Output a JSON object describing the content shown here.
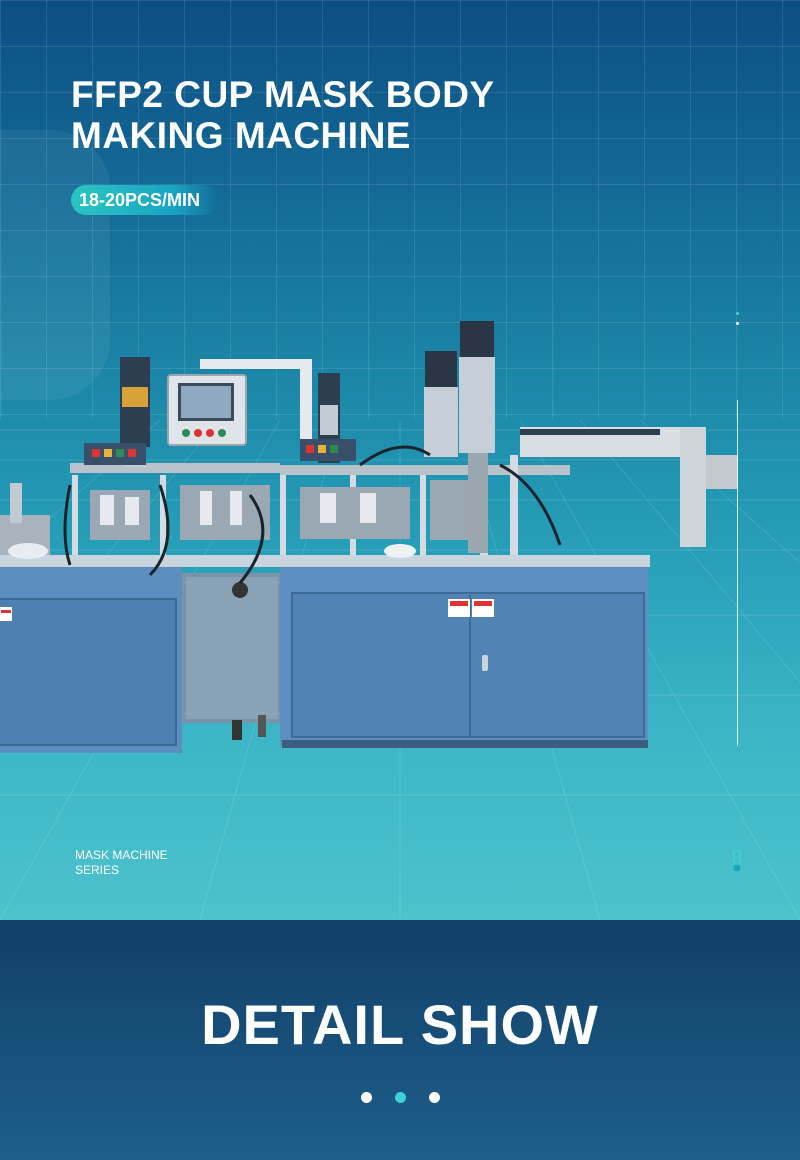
{
  "hero": {
    "title": "FFP2  CUP MASK BODY\nMAKING MACHINE",
    "rate_badge": "18-20PCS/MIN",
    "series_label": "MASK MACHINE\nSERIES",
    "colors": {
      "accent": "#3fd1d6",
      "badge_start": "#29c6c0",
      "badge_end": "#1aa3c4"
    }
  },
  "detail": {
    "title": "DETAIL SHOW",
    "pager": [
      {
        "active": false
      },
      {
        "active": true
      },
      {
        "active": false
      }
    ]
  }
}
